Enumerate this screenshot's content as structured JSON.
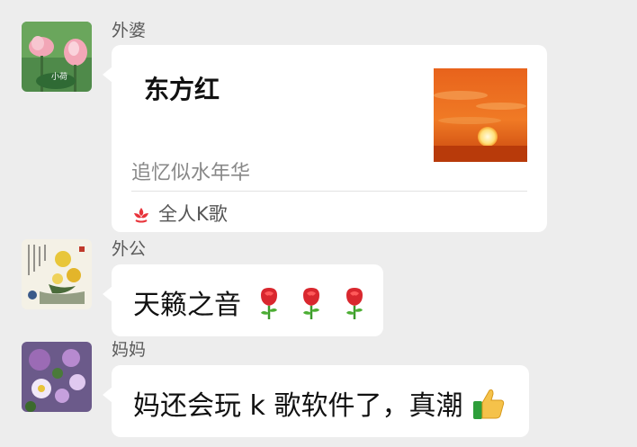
{
  "messages": [
    {
      "sender": "外婆",
      "card": {
        "title": "东方红",
        "description": "追忆似水年华",
        "source": "全人K歌",
        "source_icon": "kge-logo-icon",
        "thumbnail": "sunset-image"
      }
    },
    {
      "sender": "外公",
      "text": "天籁之音",
      "emojis": [
        "rose-icon",
        "rose-icon",
        "rose-icon"
      ]
    },
    {
      "sender": "妈妈",
      "text": "妈还会玩 k 歌软件了，真潮",
      "emojis": [
        "thumbs-up-icon"
      ]
    }
  ],
  "colors": {
    "background": "#ededed",
    "bubble": "#ffffff",
    "brand_red": "#e8333a"
  }
}
